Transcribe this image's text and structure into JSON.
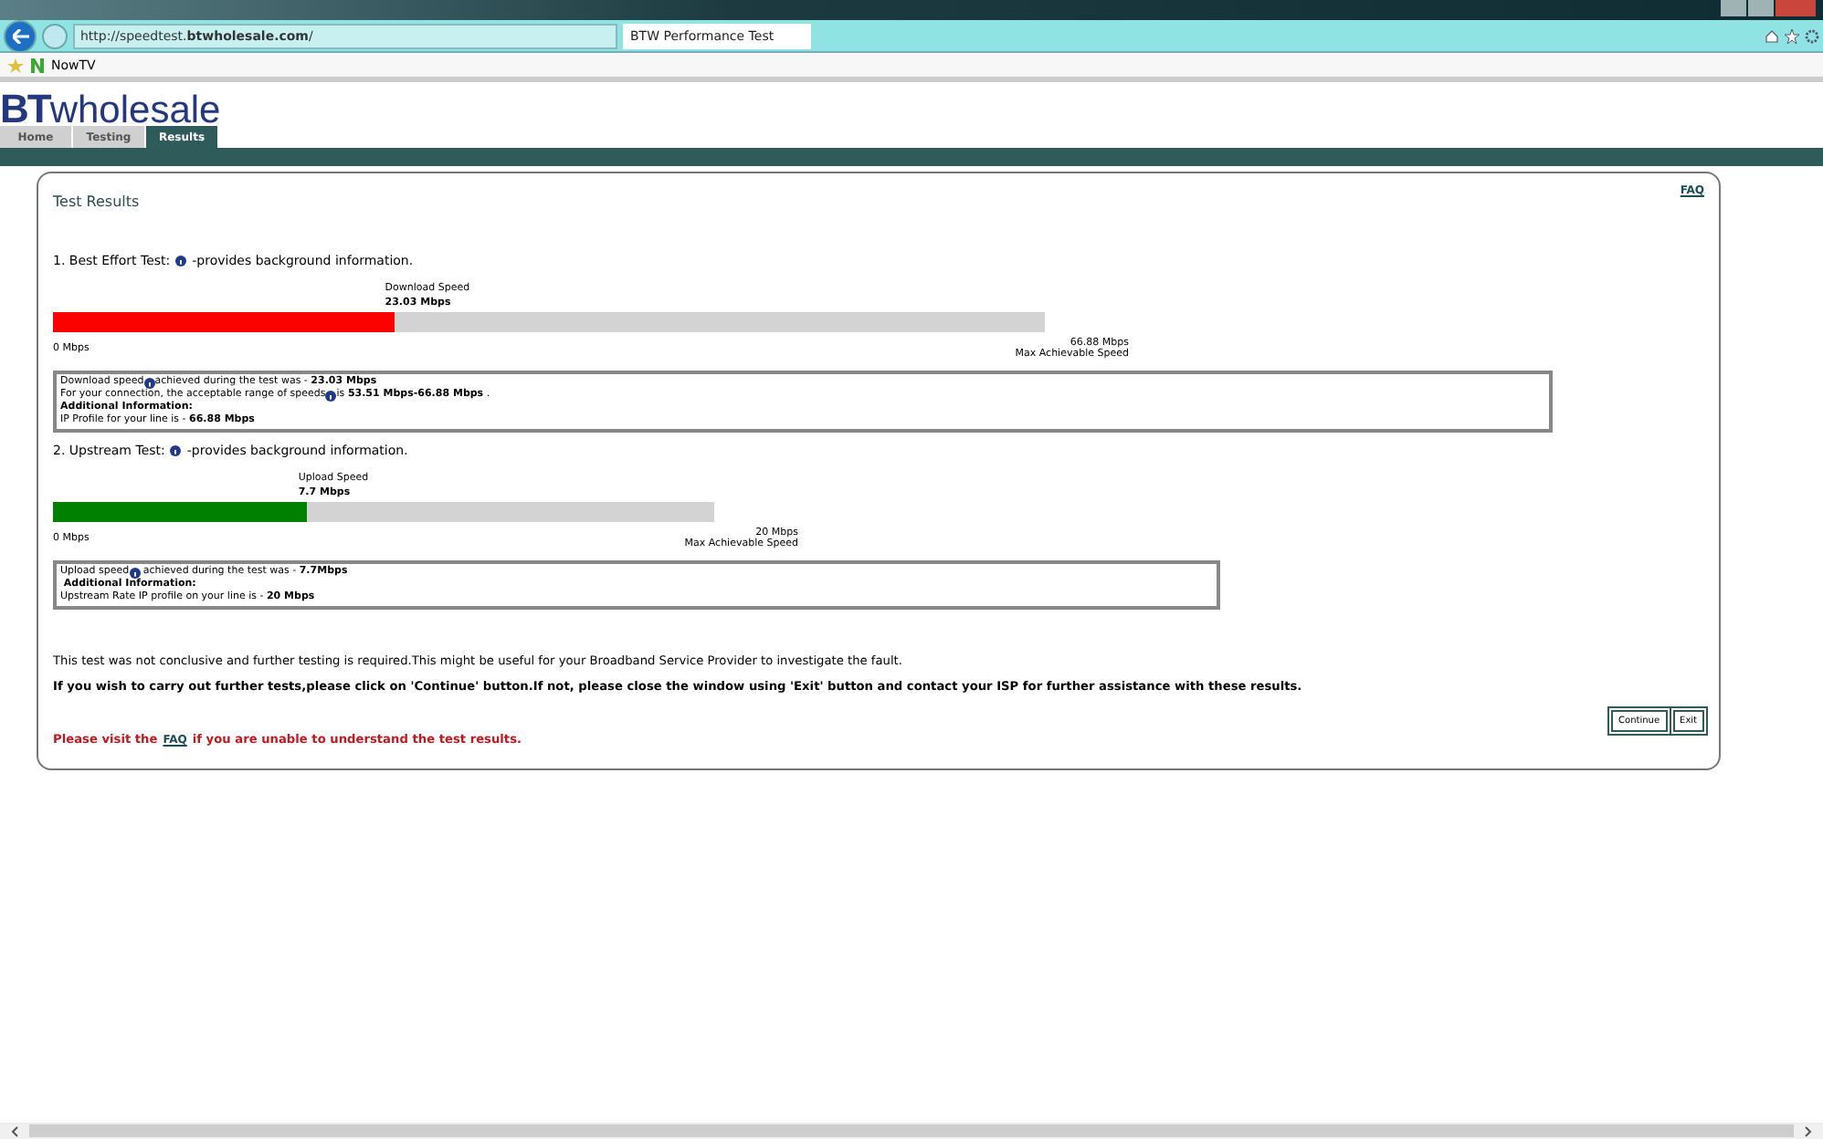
{
  "browser": {
    "url_prefix": "http://speedtest.",
    "url_domain": "btwholesale.com",
    "url_suffix": "/",
    "tab_title": "BTW Performance Test",
    "favorites": [
      "NowTV"
    ]
  },
  "logo": {
    "mark": "BT",
    "word": "wholesale"
  },
  "nav": [
    {
      "label": "Home",
      "selected": false
    },
    {
      "label": "Testing",
      "selected": false
    },
    {
      "label": "Results",
      "selected": true
    }
  ],
  "heading": "Test Results",
  "faq": "FAQ",
  "tests": [
    {
      "title": "1. Best Effort Test:",
      "subtitle": "-provides background information.",
      "color": "#ff0000",
      "speed_label": "Download Speed",
      "speed": "23.03 Mbps",
      "level": 0.344,
      "min": "0 Mbps",
      "max": "66.88 Mbps",
      "max_label": "Max Achievable Speed",
      "info": [
        {
          "kind": "icon",
          "before": "Download speed",
          "after": "achieved during the test was - **23.03 Mbps**"
        },
        {
          "kind": "icon",
          "before": "For your connection, the acceptable range of speeds",
          "after": "is **53.51 Mbps-66.88 Mbps** ."
        },
        {
          "kind": "bold",
          "text": "Additional Information:"
        },
        {
          "kind": "plain",
          "text": "IP Profile for your line is - **66.88 Mbps**"
        }
      ]
    },
    {
      "title": "2. Upstream Test:",
      "subtitle": "-provides background information.",
      "color": "#008000",
      "speed_label": "Upload Speed",
      "speed": "7.7 Mbps",
      "level": 0.385,
      "min": "0 Mbps",
      "max": "20 Mbps",
      "max_label": "Max Achievable Speed",
      "info": [
        {
          "kind": "icon",
          "before": "Upload speed",
          "after": " achieved during the test was - **7.7Mbps**"
        },
        {
          "kind": "bold",
          "text": " Additional Information:"
        },
        {
          "kind": "plain",
          "text": "Upstream Rate IP profile on your line is - **20 Mbps**"
        }
      ]
    }
  ],
  "note": "This test was not conclusive and further testing is required.This might be useful for your Broadband Service Provider to investigate the fault.",
  "instruction": "If you wish to carry out further tests,please click on 'Continue' button.If not, please close the window using 'Exit' button and contact your ISP for further assistance with these results.",
  "buttons": [
    "Continue",
    "Exit"
  ],
  "help": {
    "before": "Please visit the",
    "link": "FAQ",
    "after": "if you are unable to understand the test results."
  }
}
